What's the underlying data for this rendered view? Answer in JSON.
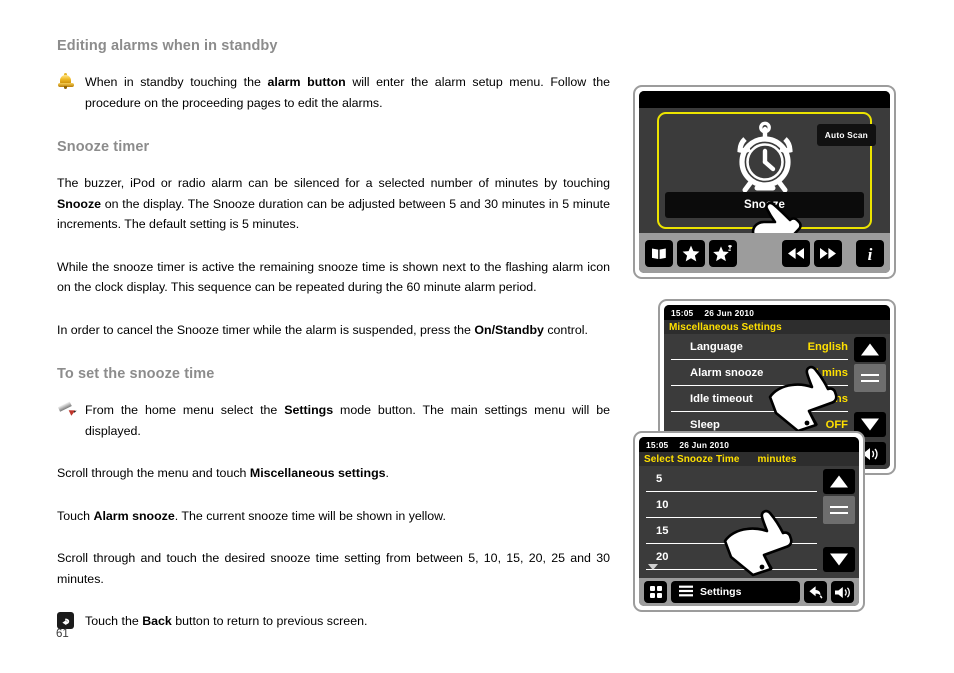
{
  "page": {
    "number": "61"
  },
  "sections": [
    {
      "heading": "Editing alarms when in standby",
      "bullet_icon": "bell-icon",
      "bullet_text_parts": [
        {
          "t": "When in standby touching the ",
          "b": false
        },
        {
          "t": "alarm button",
          "b": true
        },
        {
          "t": " will enter the alarm setup menu. Follow the procedure on the proceeding pages to edit the alarms.",
          "b": false
        }
      ]
    },
    {
      "heading": "Snooze timer",
      "paragraphs": [
        [
          {
            "t": "The buzzer, iPod or radio alarm can be silenced for a selected number of minutes by touching ",
            "b": false
          },
          {
            "t": "Snooze",
            "b": true
          },
          {
            "t": " on the display. The Snooze duration can be adjusted between 5 and 30 minutes in 5 minute increments. The default setting is 5 minutes.",
            "b": false
          }
        ],
        [
          {
            "t": "While the snooze timer is active the remaining snooze time is shown next to the flashing alarm icon on the clock display. This sequence can be repeated during the 60 minute alarm period.",
            "b": false
          }
        ],
        [
          {
            "t": "In order to cancel the Snooze timer while the alarm is suspended, press the ",
            "b": false
          },
          {
            "t": "On/Standby",
            "b": true
          },
          {
            "t": " control.",
            "b": false
          }
        ]
      ]
    },
    {
      "heading": "To set the snooze time",
      "bullet_icon": "pencil-icon",
      "bullet_text_parts": [
        {
          "t": "From the home menu select the ",
          "b": false
        },
        {
          "t": "Settings",
          "b": true
        },
        {
          "t": " mode button. The main settings menu will be displayed.",
          "b": false
        }
      ],
      "paragraphs": [
        [
          {
            "t": "Scroll through the menu and touch ",
            "b": false
          },
          {
            "t": "Miscellaneous settings",
            "b": true
          },
          {
            "t": ".",
            "b": false
          }
        ],
        [
          {
            "t": "Touch ",
            "b": false
          },
          {
            "t": "Alarm snooze",
            "b": true
          },
          {
            "t": ". The current snooze time will be shown in yellow.",
            "b": false
          }
        ],
        [
          {
            "t": "Scroll through and touch the desired snooze time setting from between 5, 10, 15, 20, 25 and 30 minutes.",
            "b": false
          }
        ]
      ],
      "footer_bullet_icon": "back-button-icon",
      "footer_bullet_parts": [
        {
          "t": "Touch the ",
          "b": false
        },
        {
          "t": "Back",
          "b": true
        },
        {
          "t": " button to return to previous screen.",
          "b": false
        }
      ]
    }
  ],
  "device1": {
    "name": "alarm-standby-screen",
    "auto_scan_label": "Auto Scan",
    "snooze_label": "Snooze",
    "highlight_color": "#ece400",
    "icons": [
      "book-icon",
      "star-icon",
      "star-plus-icon",
      "rewind-icon",
      "fast-forward-icon",
      "info-icon"
    ]
  },
  "device2": {
    "name": "miscellaneous-settings-screen",
    "time": "15:05",
    "date": "26 Jun 2010",
    "title": "Miscellaneous Settings",
    "rows": [
      {
        "label": "Language",
        "value": "English"
      },
      {
        "label": "Alarm snooze",
        "value": "5 mins"
      },
      {
        "label": "Idle timeout",
        "value": "5 mins"
      },
      {
        "label": "Sleep",
        "value": "OFF"
      }
    ],
    "value_color": "#ffe000",
    "icons": [
      "scroll-up-icon",
      "scroll-thumb-icon",
      "scroll-down-icon",
      "volume-icon"
    ]
  },
  "device3": {
    "name": "select-snooze-time-screen",
    "time": "15:05",
    "date": "26 Jun 2010",
    "title": "Select Snooze Time",
    "unit": "minutes",
    "options": [
      "5",
      "10",
      "15",
      "20"
    ],
    "toolbar": {
      "grid_icon": "grid-icon",
      "menu_icon": "menu-icon",
      "settings_label": "Settings",
      "back_icon": "back-icon",
      "volume_icon": "volume-icon"
    },
    "icons": [
      "scroll-up-icon",
      "scroll-thumb-icon",
      "scroll-down-icon"
    ]
  }
}
